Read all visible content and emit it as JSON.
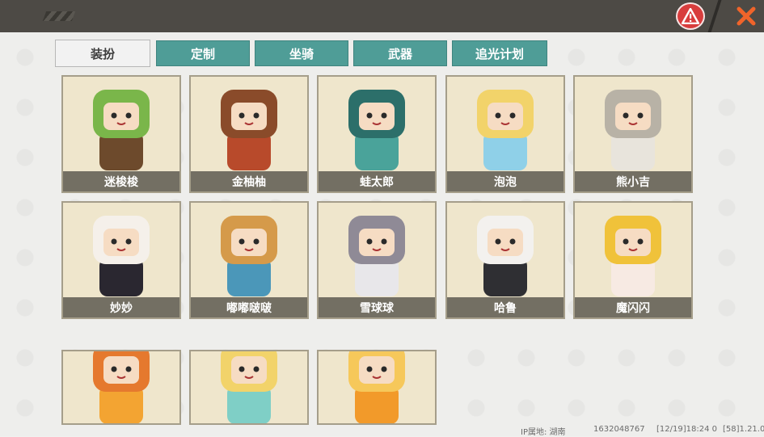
{
  "topbar": {
    "left_glyph": "ᡃ",
    "warning_icon": "warning-icon",
    "close_icon": "close-icon",
    "colors": {
      "bar": "#4d4a45",
      "warn": "#d83d3d",
      "close": "#f0642a"
    }
  },
  "tabs": [
    {
      "label": "装扮",
      "active": true
    },
    {
      "label": "定制",
      "active": false
    },
    {
      "label": "坐骑",
      "active": false
    },
    {
      "label": "武器",
      "active": false
    },
    {
      "label": "追光计划",
      "active": false
    }
  ],
  "characters": [
    {
      "name": "迷梭梭",
      "colors": [
        "#6d4a2c",
        "#7ab64a"
      ]
    },
    {
      "name": "金柚柚",
      "colors": [
        "#b84a2b",
        "#8a4b2a"
      ]
    },
    {
      "name": "蛙太郎",
      "colors": [
        "#4aa39a",
        "#2c6f6a"
      ]
    },
    {
      "name": "泡泡",
      "colors": [
        "#8fd0e8",
        "#f2d36a"
      ]
    },
    {
      "name": "熊小吉",
      "colors": [
        "#e8e4dc",
        "#b8b2a6"
      ]
    },
    {
      "name": "妙妙",
      "colors": [
        "#2a2730",
        "#f5f0ea"
      ]
    },
    {
      "name": "嘟嘟啵啵",
      "colors": [
        "#4b97b9",
        "#d59a4a"
      ]
    },
    {
      "name": "雪球球",
      "colors": [
        "#e8e7ea",
        "#8f8a96"
      ]
    },
    {
      "name": "哈鲁",
      "colors": [
        "#2f2f33",
        "#f3f1ee"
      ]
    },
    {
      "name": "魔闪闪",
      "colors": [
        "#f7eae3",
        "#f0c23a"
      ]
    },
    {
      "name": "",
      "colors": [
        "#f3a432",
        "#e5792e"
      ]
    },
    {
      "name": "",
      "colors": [
        "#7fcfc6",
        "#f2d36a"
      ]
    },
    {
      "name": "",
      "colors": [
        "#f29a2a",
        "#f6c85a"
      ]
    }
  ],
  "footer": {
    "ip": "IP属地: 湖南",
    "uid": "1632048767",
    "time": "[12/19]18:24 0",
    "version": "[58]1.21.0"
  }
}
